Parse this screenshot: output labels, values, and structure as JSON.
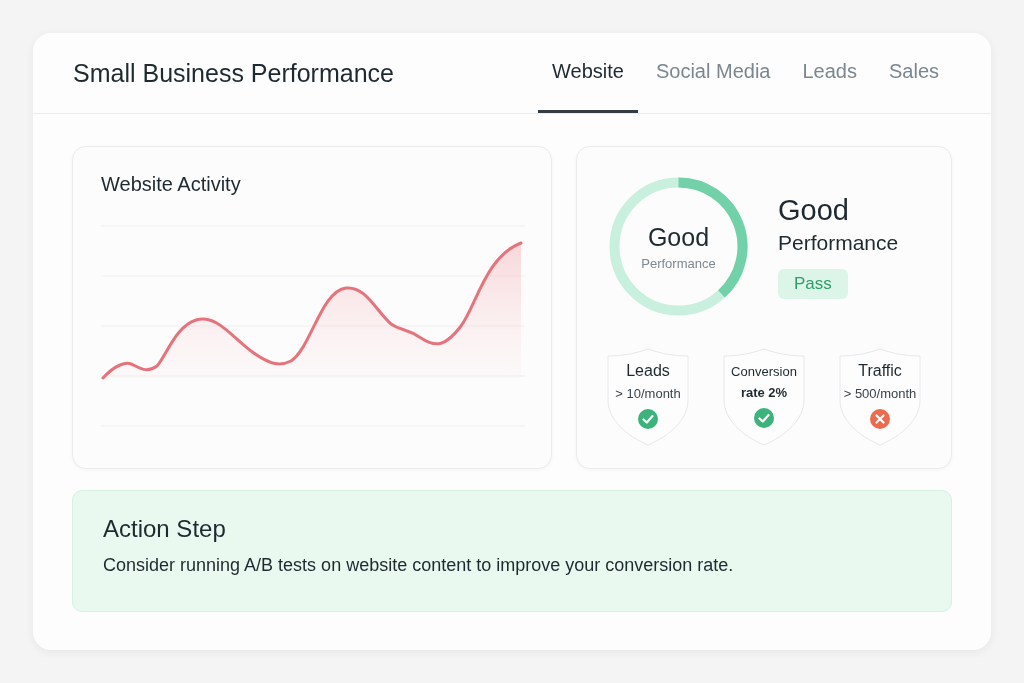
{
  "header": {
    "title": "Small Business Performance"
  },
  "tabs": [
    {
      "label": "Website",
      "selected": true
    },
    {
      "label": "Social Media",
      "selected": false
    },
    {
      "label": "Leads",
      "selected": false
    },
    {
      "label": "Sales",
      "selected": false
    }
  ],
  "activity": {
    "title": "Website Activity"
  },
  "performance": {
    "gauge": {
      "label": "Good",
      "caption": "Performance"
    },
    "rating": "Good",
    "subtitle": "Performance",
    "badge": "Pass",
    "criteria": [
      {
        "label": "Leads",
        "detail": "> 10/month",
        "emphasized": false,
        "passed": true
      },
      {
        "label": "Conversion",
        "detail": "rate 2%",
        "emphasized": true,
        "passed": true
      },
      {
        "label": "Traffic",
        "detail": "> 500/month",
        "emphasized": false,
        "passed": false
      }
    ]
  },
  "action": {
    "title": "Action Step",
    "text": "Consider running A/B tests on website content to improve your conversion rate."
  }
}
